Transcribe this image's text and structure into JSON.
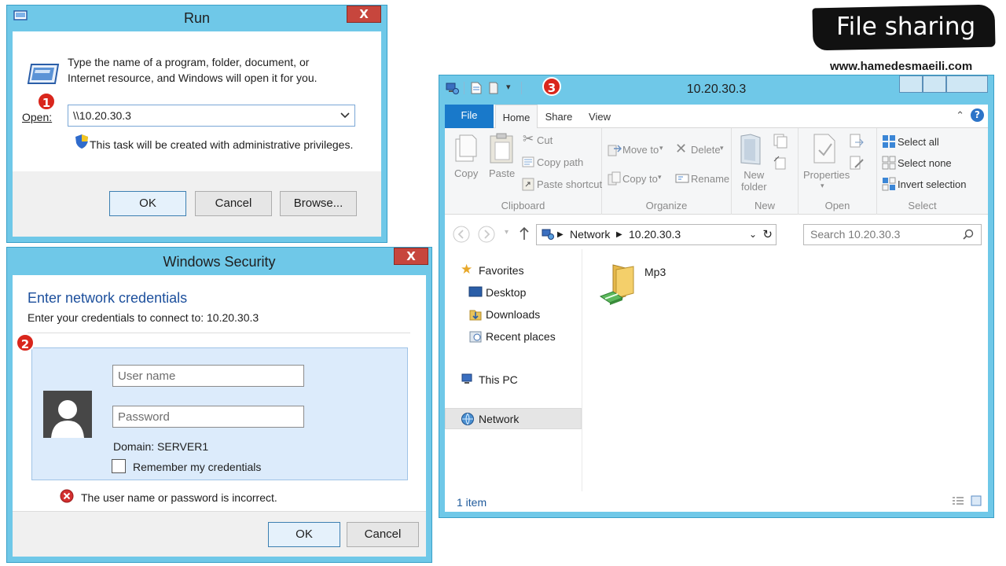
{
  "banner": {
    "title": "File sharing",
    "website": "www.hamedesmaeili.com"
  },
  "steps": [
    "1",
    "2",
    "3"
  ],
  "run_dialog": {
    "title": "Run",
    "close": "X",
    "description_line1": "Type the name of a program, folder, document, or",
    "description_line2": "Internet resource, and Windows will open it for you.",
    "open_label": "Open:",
    "open_value": "\\\\10.20.30.3",
    "admin_note": "This task will be created with administrative privileges.",
    "ok": "OK",
    "cancel": "Cancel",
    "browse": "Browse..."
  },
  "security_dialog": {
    "title": "Windows Security",
    "close": "X",
    "heading": "Enter network credentials",
    "subheading": "Enter your credentials to connect to: 10.20.30.3",
    "username_placeholder": "User name",
    "password_placeholder": "Password",
    "domain": "Domain: SERVER1",
    "remember": "Remember my credentials",
    "error": "The user name or password is incorrect.",
    "ok": "OK",
    "cancel": "Cancel"
  },
  "explorer": {
    "title": "10.20.30.3",
    "tabs": {
      "file": "File",
      "home": "Home",
      "share": "Share",
      "view": "View"
    },
    "clipboard": {
      "copy": "Copy",
      "paste": "Paste",
      "cut": "Cut",
      "copy_path": "Copy path",
      "paste_shortcut": "Paste shortcut",
      "label": "Clipboard"
    },
    "organize": {
      "move_to": "Move to",
      "copy_to": "Copy to",
      "delete": "Delete",
      "rename": "Rename",
      "label": "Organize"
    },
    "new": {
      "new_folder_1": "New",
      "new_folder_2": "folder",
      "label": "New"
    },
    "open": {
      "properties": "Properties",
      "label": "Open"
    },
    "select": {
      "select_all": "Select all",
      "select_none": "Select none",
      "invert": "Invert selection",
      "label": "Select"
    },
    "address": {
      "part1": "Network",
      "part2": "10.20.30.3"
    },
    "search_placeholder": "Search 10.20.30.3",
    "nav": {
      "favorites": "Favorites",
      "desktop": "Desktop",
      "downloads": "Downloads",
      "recent": "Recent places",
      "this_pc": "This PC",
      "network": "Network"
    },
    "items": [
      {
        "name": "Mp3"
      }
    ],
    "status": "1 item"
  }
}
